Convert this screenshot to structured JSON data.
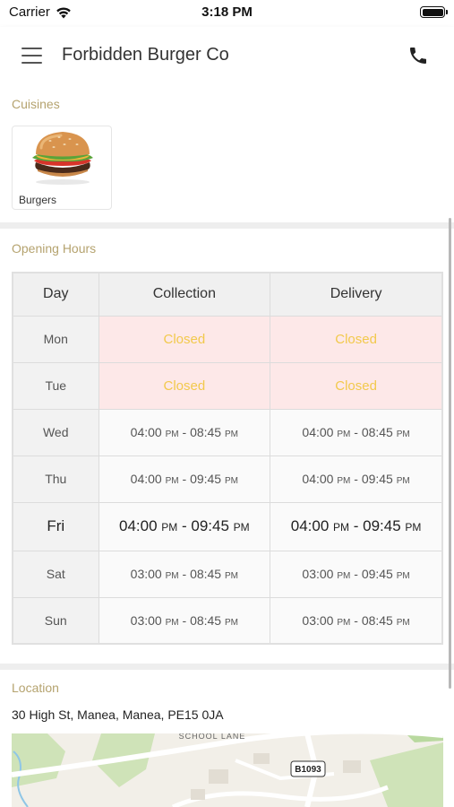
{
  "status_bar": {
    "carrier": "Carrier",
    "time": "3:18 PM"
  },
  "header": {
    "title": "Forbidden Burger Co",
    "menu_icon": "hamburger-menu-icon",
    "phone_icon": "phone-icon"
  },
  "cuisines": {
    "label": "Cuisines",
    "items": [
      {
        "name": "Burgers",
        "image": "burger-image"
      }
    ]
  },
  "opening_hours": {
    "label": "Opening Hours",
    "columns": [
      "Day",
      "Collection",
      "Delivery"
    ],
    "rows": [
      {
        "day": "Mon",
        "collection": {
          "closed": true,
          "text": "Closed"
        },
        "delivery": {
          "closed": true,
          "text": "Closed"
        }
      },
      {
        "day": "Tue",
        "collection": {
          "closed": true,
          "text": "Closed"
        },
        "delivery": {
          "closed": true,
          "text": "Closed"
        }
      },
      {
        "day": "Wed",
        "collection": {
          "from": "04:00",
          "to": "08:45",
          "suffix": "PM"
        },
        "delivery": {
          "from": "04:00",
          "to": "08:45",
          "suffix": "PM"
        }
      },
      {
        "day": "Thu",
        "collection": {
          "from": "04:00",
          "to": "09:45",
          "suffix": "PM"
        },
        "delivery": {
          "from": "04:00",
          "to": "09:45",
          "suffix": "PM"
        }
      },
      {
        "day": "Fri",
        "today": true,
        "collection": {
          "from": "04:00",
          "to": "09:45",
          "suffix": "PM"
        },
        "delivery": {
          "from": "04:00",
          "to": "09:45",
          "suffix": "PM"
        }
      },
      {
        "day": "Sat",
        "collection": {
          "from": "03:00",
          "to": "08:45",
          "suffix": "PM"
        },
        "delivery": {
          "from": "03:00",
          "to": "09:45",
          "suffix": "PM"
        }
      },
      {
        "day": "Sun",
        "collection": {
          "from": "03:00",
          "to": "08:45",
          "suffix": "PM"
        },
        "delivery": {
          "from": "03:00",
          "to": "08:45",
          "suffix": "PM"
        }
      }
    ],
    "closed_text_color": "#f2c94c",
    "closed_bg_color": "#fde8e8"
  },
  "location": {
    "label": "Location",
    "address": "30 High St, Manea, Manea, PE15 0JA",
    "map": {
      "road_label": "SCHOOL LANE",
      "road_sign": "B1093"
    }
  },
  "colors": {
    "accent": "#b5a36f"
  }
}
